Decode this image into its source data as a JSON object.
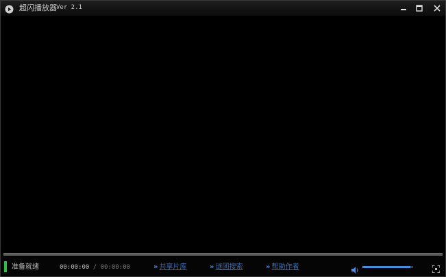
{
  "window": {
    "title": "超闪播放器",
    "version": "Ver 2.1",
    "buttons": {
      "minimize_icon": "minimize-icon",
      "maximize_icon": "maximize-icon",
      "close_icon": "close-icon"
    }
  },
  "player": {
    "status": "准备就绪",
    "status_color": "#29c43c",
    "time_current": "00:00:00",
    "time_separator": "/",
    "time_total": "00:00:00",
    "progress_fraction": 0,
    "volume_fraction": 0.95
  },
  "links": [
    {
      "icon": "»",
      "label": "共享片库"
    },
    {
      "icon": "»",
      "label": "谜团搜索"
    },
    {
      "icon": "»",
      "label": "帮助作者"
    }
  ],
  "colors": {
    "accent": "#4a90e0",
    "link": "#3b6aa8",
    "background": "#000000"
  }
}
